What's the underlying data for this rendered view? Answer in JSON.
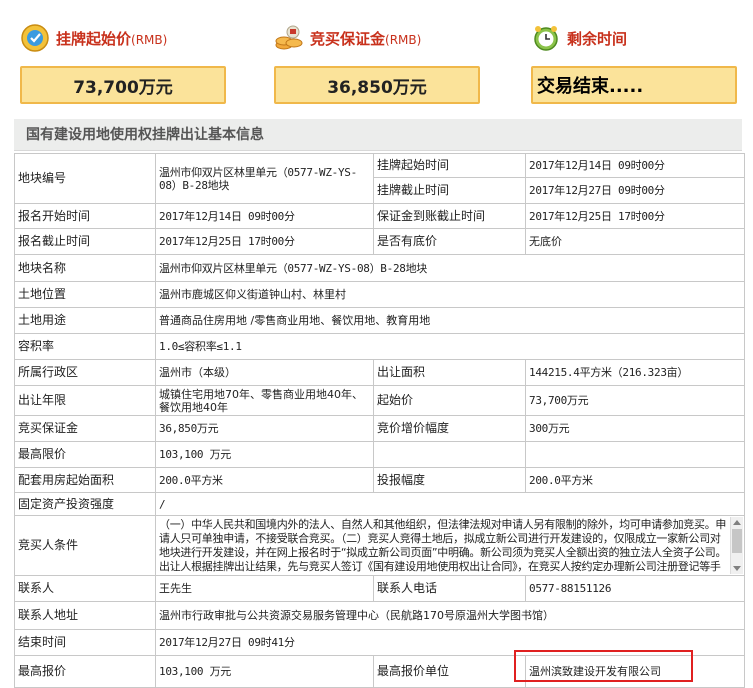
{
  "header": {
    "start_price": {
      "label": "挂牌起始价",
      "unit": "(RMB)",
      "value": "73,700万元"
    },
    "deposit": {
      "label": "竞买保证金",
      "unit": "(RMB)",
      "value": "36,850万元"
    },
    "remaining": {
      "label": "剩余时间",
      "value": "交易结束....."
    },
    "icons": [
      "money-bag-icon",
      "coins-icon",
      "alarm-clock-icon"
    ]
  },
  "section_title": "国有建设用地使用权挂牌出让基本信息",
  "info": {
    "parcel_no_k": "地块编号",
    "parcel_no_v": "温州市仰双片区林里单元（0577-WZ-YS-08）B-28地块",
    "list_start_k": "挂牌起始时间",
    "list_start_v": "2017年12月14日 09时00分",
    "list_end_k": "挂牌截止时间",
    "list_end_v": "2017年12月27日 09时00分",
    "reg_start_k": "报名开始时间",
    "reg_start_v": "2017年12月14日 09时00分",
    "deposit_deadline_k": "保证金到账截止时间",
    "deposit_deadline_v": "2017年12月25日 17时00分",
    "reg_end_k": "报名截止时间",
    "reg_end_v": "2017年12月25日 17时00分",
    "reserve_k": "是否有底价",
    "reserve_v": "无底价",
    "parcel_name_k": "地块名称",
    "parcel_name_v": "温州市仰双片区林里单元（0577-WZ-YS-08）B-28地块",
    "location_k": "土地位置",
    "location_v": "温州市鹿城区仰义街道钟山村、林里村",
    "use_k": "土地用途",
    "use_v": "普通商品住房用地 /零售商业用地、餐饮用地、教育用地",
    "far_k": "容积率",
    "far_v": "1.0≤容积率≤1.1",
    "district_k": "所属行政区",
    "district_v": "温州市（本级）",
    "area_k": "出让面积",
    "area_v": "144215.4平方米（216.323亩）",
    "term_k": "出让年限",
    "term_v": "城镇住宅用地70年、零售商业用地40年、餐饮用地40年",
    "start_price_k": "起始价",
    "start_price_v": "73,700万元",
    "deposit_k": "竞买保证金",
    "deposit_v": "36,850万元",
    "increment_k": "竞价增价幅度",
    "increment_v": "300万元",
    "max_price_k": "最高限价",
    "max_price_v": "103,100 万元",
    "housing_area_k": "配套用房起始面积",
    "housing_area_v": "200.0平方米",
    "bid_step_k": "投报幅度",
    "bid_step_v": "200.0平方米",
    "fixed_invest_k": "固定资产投资强度",
    "fixed_invest_v": "/",
    "bidder_cond_k": "竞买人条件",
    "bidder_cond_v": "（一）中华人民共和国境内外的法人、自然人和其他组织，但法律法规对申请人另有限制的除外，均可申请参加竞买。申请人只可单独申请，不接受联合竞买。（二）竞买人竞得土地后，拟成立新公司进行开发建设的，仅限成立一家新公司对地块进行开发建设，并在网上报名时于“拟成立新公司页面”中明确。新公司须为竞买人全额出资的独立法人全资子公司。出让人根据挂牌出让结果，先与竞买人签订《国有建设用地使用权出让合同》，在竞买人按约定办理新公司注册登记等手续后，再与新公司变更《国有建设用地使用权出让合同》",
    "contact_k": "联系人",
    "contact_v": "王先生",
    "phone_k": "联系人电话",
    "phone_v": "0577-88151126",
    "address_k": "联系人地址",
    "address_v": "温州市行政审批与公共资源交易服务管理中心（民航路170号原温州大学图书馆）",
    "end_time_k": "结束时间",
    "end_time_v": "2017年12月27日 09时41分",
    "top_bid_k": "最高报价",
    "top_bid_v": "103,100 万元",
    "top_bidder_k": "最高报价单位",
    "top_bidder_v": "温州滨致建设开发有限公司"
  },
  "colors": {
    "label_red": "#c8311c",
    "stat_box_bg": "#fbe39a",
    "stat_box_border": "#f0b84a",
    "highlight": "#e02020"
  }
}
